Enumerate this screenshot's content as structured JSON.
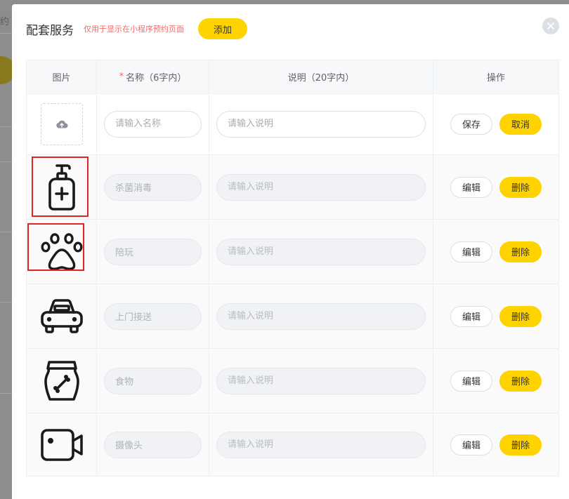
{
  "background": {
    "partial_text": "约"
  },
  "dialog": {
    "title": "配套服务",
    "hint": "仅用于显示在小程序预约页面",
    "add_label": "添加",
    "close_icon": "close-icon"
  },
  "table": {
    "headers": {
      "image": "图片",
      "name_required_mark": "*",
      "name": "名称（6字内）",
      "description": "说明（20字内）",
      "actions": "操作"
    },
    "new_row": {
      "upload_icon": "cloud-upload-icon",
      "name_placeholder": "请输入名称",
      "desc_placeholder": "请输入说明",
      "save_label": "保存",
      "cancel_label": "取消"
    },
    "rows": [
      {
        "icon": "sanitizer-bottle-icon",
        "name": "杀菌消毒",
        "desc_placeholder": "请输入说明",
        "edit_label": "编辑",
        "delete_label": "删除",
        "highlighted": true
      },
      {
        "icon": "paw-icon",
        "name": "陪玩",
        "desc_placeholder": "请输入说明",
        "edit_label": "编辑",
        "delete_label": "删除",
        "highlighted": true
      },
      {
        "icon": "car-icon",
        "name": "上门接送",
        "desc_placeholder": "请输入说明",
        "edit_label": "编辑",
        "delete_label": "删除",
        "highlighted": false
      },
      {
        "icon": "pet-food-bag-icon",
        "name": "食物",
        "desc_placeholder": "请输入说明",
        "edit_label": "编辑",
        "delete_label": "删除",
        "highlighted": false
      },
      {
        "icon": "camera-icon",
        "name": "摄像头",
        "desc_placeholder": "请输入说明",
        "edit_label": "编辑",
        "delete_label": "删除",
        "highlighted": false
      }
    ]
  },
  "colors": {
    "accent": "#ffd300",
    "hint": "#f56c6c",
    "highlight_box": "#e02424"
  }
}
